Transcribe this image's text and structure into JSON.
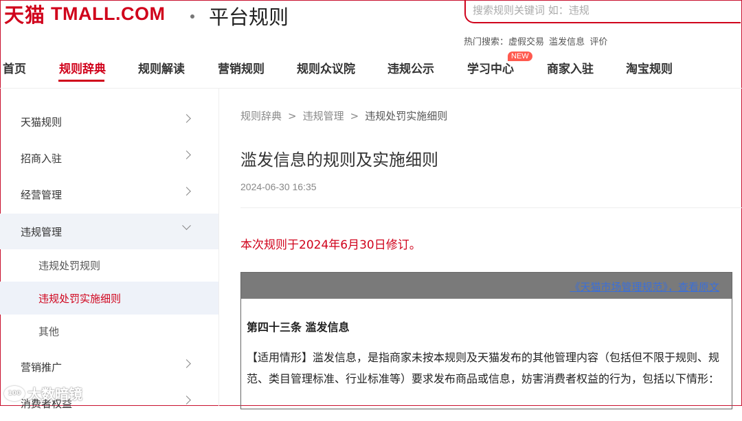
{
  "header": {
    "logo_cn": "天猫",
    "logo_en": "TMALL.COM",
    "platform_title": "平台规则",
    "search_placeholder": "搜索规则关键词 如：违规",
    "hot_label": "热门搜索：",
    "hot_keywords": [
      "虚假交易",
      "滥发信息",
      "评价"
    ]
  },
  "nav": {
    "items": [
      "首页",
      "规则辞典",
      "规则解读",
      "营销规则",
      "规则众议院",
      "违规公示",
      "学习中心",
      "商家入驻",
      "淘宝规则"
    ],
    "active": "规则辞典",
    "badge": "NEW"
  },
  "sidebar": {
    "items": [
      "天猫规则",
      "招商入驻",
      "经营管理",
      "违规管理",
      "营销推广",
      "消费者权益"
    ],
    "sub_items": [
      "违规处罚规则",
      "违规处罚实施细则",
      "其他"
    ],
    "open_item": "违规管理",
    "active_sub": "违规处罚实施细则"
  },
  "breadcrumb": {
    "items": [
      "规则辞典",
      "违规管理",
      "违规处罚实施细则"
    ],
    "separator": ">"
  },
  "article": {
    "title": "滥发信息的规则及实施细则",
    "date": "2024-06-30 16:35",
    "revision_note": "本次规则于2024年6月30日修订。",
    "quote_link": "《天猫市场管理规范》，查看原文",
    "clause_heading": "第四十三条 滥发信息",
    "clause_text": "【适用情形】滥发信息，是指商家未按本规则及天猫发布的其他管理内容（包括但不限于规则、规范、类目管理标准、行业标准等）要求发布商品或信息，妨害消费者权益的行为，包括以下情形："
  },
  "watermark": {
    "text": "大数暗镜",
    "logo_text": "100"
  },
  "colors": {
    "brand": "#d0021b",
    "badge": "#ff5a4f",
    "link": "#3b6fd8",
    "sidebar_active_bg": "#eef2f9",
    "quote_header": "#7a7a7a"
  }
}
